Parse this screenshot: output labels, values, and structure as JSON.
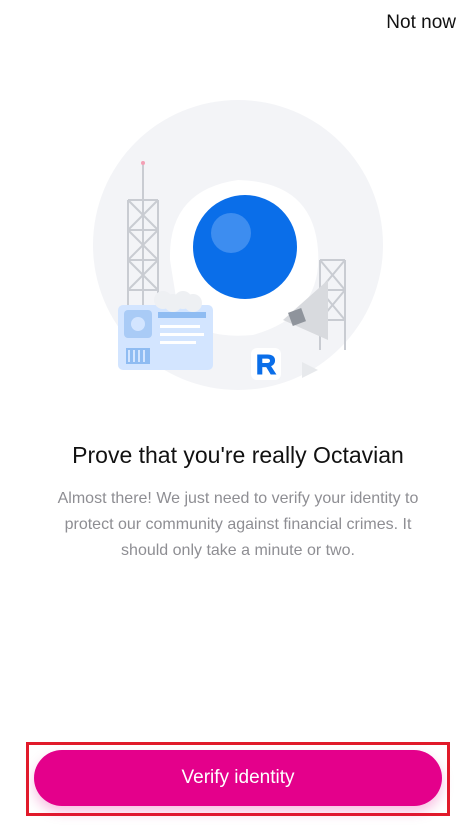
{
  "header": {
    "not_now_label": "Not now"
  },
  "hero": {
    "badge_letter": "R"
  },
  "main": {
    "title": "Prove that you're really Octavian",
    "description": "Almost there! We just need to verify your identity to protect our community against financial crimes. It should only take a minute or two."
  },
  "footer": {
    "verify_label": "Verify identity"
  },
  "colors": {
    "accent": "#e4008b",
    "brand_blue": "#0a6ee9",
    "highlight_border": "#e11a2a"
  }
}
